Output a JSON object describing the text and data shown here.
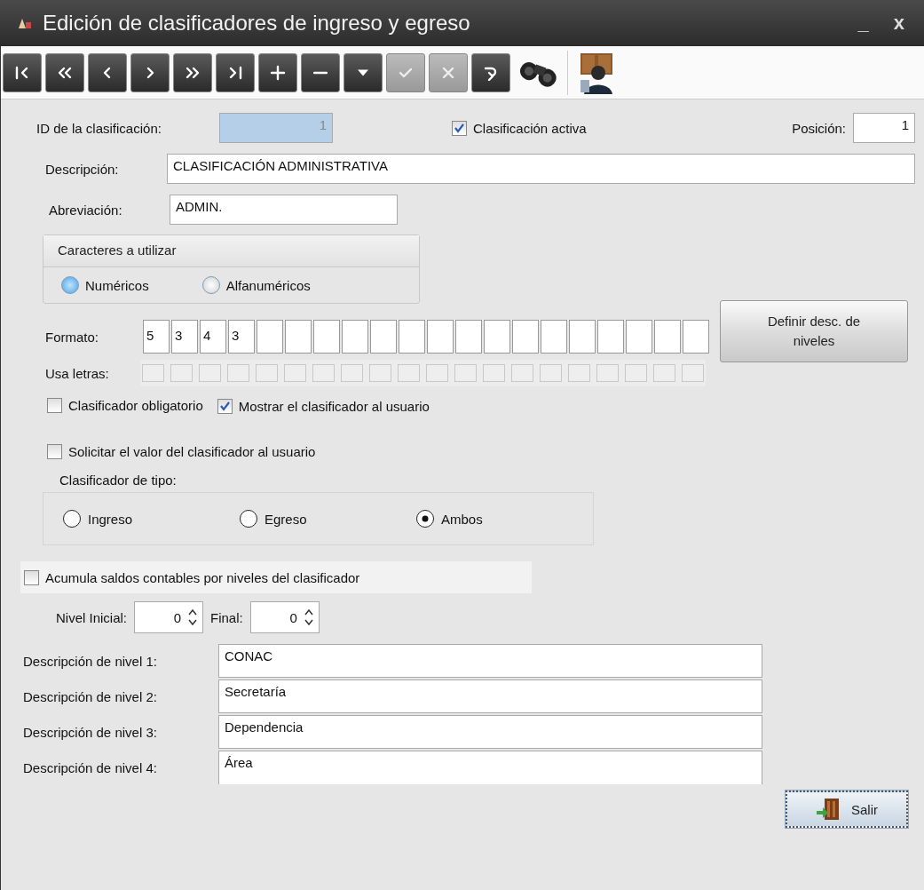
{
  "window": {
    "title": "Edición de clasificadores de ingreso y egreso",
    "minimize": "_",
    "close": "x"
  },
  "toolbar": [
    {
      "kind": "first",
      "disabled": false
    },
    {
      "kind": "prev-page",
      "disabled": false
    },
    {
      "kind": "prev",
      "disabled": false
    },
    {
      "kind": "next",
      "disabled": false
    },
    {
      "kind": "next-page",
      "disabled": false
    },
    {
      "kind": "last",
      "disabled": false
    },
    {
      "kind": "add",
      "disabled": false
    },
    {
      "kind": "remove",
      "disabled": false
    },
    {
      "kind": "down",
      "disabled": false
    },
    {
      "kind": "accept",
      "disabled": true
    },
    {
      "kind": "cancel",
      "disabled": true
    },
    {
      "kind": "redo",
      "disabled": false
    },
    {
      "kind": "search"
    },
    {
      "kind": "user"
    }
  ],
  "id_field": {
    "label": "ID de la clasificación:",
    "value": "1"
  },
  "active": {
    "label": "Clasificación activa",
    "checked": true
  },
  "position": {
    "label": "Posición:",
    "value": "1"
  },
  "description": {
    "label": "Descripción:",
    "value": "CLASIFICACIÓN ADMINISTRATIVA"
  },
  "abbreviation": {
    "label": "Abreviación:",
    "value": "ADMIN."
  },
  "characters": {
    "title": "Caracteres a utilizar",
    "options": [
      {
        "label": "Numéricos",
        "selected": true
      },
      {
        "label": "Alfanuméricos",
        "selected": false
      }
    ]
  },
  "format": {
    "label": "Formato:",
    "cells": [
      "5",
      "3",
      "4",
      "3",
      "",
      "",
      "",
      "",
      "",
      "",
      "",
      "",
      "",
      "",
      "",
      "",
      "",
      "",
      "",
      ""
    ]
  },
  "letters": {
    "label": "Usa letras:",
    "boxes": [
      {
        "checked": false
      },
      {
        "checked": false
      },
      {
        "checked": false
      },
      {
        "checked": false
      },
      {
        "checked": false
      },
      {
        "checked": false
      },
      {
        "checked": false
      },
      {
        "checked": false
      },
      {
        "checked": false
      },
      {
        "checked": false
      },
      {
        "checked": false
      },
      {
        "checked": false
      },
      {
        "checked": false
      },
      {
        "checked": false
      },
      {
        "checked": false
      },
      {
        "checked": false
      },
      {
        "checked": false
      },
      {
        "checked": false
      },
      {
        "checked": false
      },
      {
        "checked": false
      }
    ]
  },
  "define_button": "Definir desc. de niveles",
  "options_row": [
    {
      "label": "Clasificador obligatorio",
      "checked": false
    },
    {
      "label": "Mostrar el clasificador al usuario",
      "checked": true
    }
  ],
  "request_value": {
    "label": "Solicitar el valor del clasificador al usuario",
    "checked": false
  },
  "type": {
    "title": "Clasificador de tipo:",
    "options": [
      {
        "label": "Ingreso",
        "selected": false
      },
      {
        "label": "Egreso",
        "selected": false
      },
      {
        "label": "Ambos",
        "selected": true
      }
    ]
  },
  "accumulate": {
    "label": "Acumula saldos contables por niveles del clasificador",
    "checked": false
  },
  "levels": {
    "initial_label": "Nivel Inicial:",
    "initial": "0",
    "final_label": "Final:",
    "final": "0"
  },
  "level_descriptions": [
    {
      "label": "Descripción de nivel 1:",
      "value": "CONAC"
    },
    {
      "label": "Descripción de nivel 2:",
      "value": "Secretaría"
    },
    {
      "label": "Descripción de nivel 3:",
      "value": "Dependencia"
    },
    {
      "label": "Descripción de nivel 4:",
      "value": "Área"
    }
  ],
  "exit_button": "Salir"
}
